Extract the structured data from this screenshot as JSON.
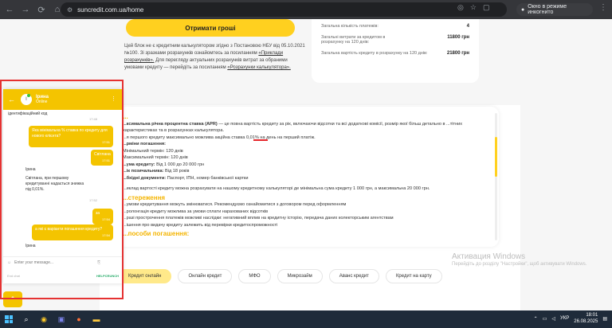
{
  "browser": {
    "url": "suncredit.com.ua/home",
    "incognito_label": "Окно в режиме инкогнито"
  },
  "top": {
    "get_money_btn": "Отримати гроші",
    "notice_text": "Цей блок не є кредитним калькулятором згідно з Постановою НБУ від 05.10.2021 №100. Зі зразками розрахунків ознайомтесь за посиланням",
    "notice_link1": "«Приклади розрахунків».",
    "notice_text2": "Для перегляду актуальних розрахунків витрат за обраними умовами кредиту — перейдіть за посиланням",
    "notice_link2": "«Розрахунки калькулятора».",
    "summary": [
      {
        "label": "Загальна кількість платежів:",
        "value": "4"
      },
      {
        "label": "Загальні витрати за кредитом в розрахунку на 120 днів:",
        "value": "11800 грн"
      },
      {
        "label": "Загальна вартість кредиту в розрахунку на 120 днів:",
        "value": "21800 грн"
      }
    ]
  },
  "apr": {
    "heading": "...",
    "line1_bold": "...ксимальна річна процентна ставка (APR)",
    "line1": "— це повна вартість кредиту за рік, включаючи відсотки та всі додаткові комісії, розмір якої більш детально в ...тітних характеристиках та в розрахунках калькулятора.",
    "line2": "...я першого кредиту максимально можлива акційна ставка 0,01% на день на перший платіж.",
    "terms_h": "...рміни погашення:",
    "term_min": "Мінімальний термін: 120 днів",
    "term_max": "Максимальний термін: 120 днів",
    "sum_label": "...ума кредиту:",
    "sum_val": "Від 1 000 до 20 000 грн",
    "borrower_label": "...ік позичальника:",
    "borrower_val": "Від 18 років",
    "docs_label": "...бхідні документи:",
    "docs_val": "Паспорт, ІПН, номер банківської картки",
    "example": "...иклад вартості кредиту можна розрахувати на нашому кредитному калькуляторі де мінімальна сума кредиту 1 000 грн, а максимальна 20 000 грн.",
    "warn_h": "...стереження",
    "warn1": "...умови кредитування можуть змінюватися. Рекомендуємо ознайомитися з договором перед оформленням",
    "warn2": "...ролонгація кредиту можлива за умови сплати нарахованих відсотків",
    "warn3": "...разі прострочення платежів можливі наслідки: негативний вплив на кредитну історію, передача даних колекторським агентствам",
    "warn4": "...ішення про видачу кредиту залежить від перевірки кредитоспроможності",
    "pay_h": "...пособи погашення:"
  },
  "pills": [
    "Кредит онлайн",
    "Онлайн кредит",
    "МФО",
    "Микрозайм",
    "Аванс кредит",
    "Кредит на карту"
  ],
  "watermark": {
    "title": "Активация Windows",
    "sub": "Перейдіть до розділу \"Настройки\", щоб активувати Windows."
  },
  "chat": {
    "agent_initial": "I",
    "agent_name": "Ірина",
    "agent_status": "Online",
    "messages": [
      {
        "from": "in",
        "text": "ідентифікаційний код",
        "time": "17:48"
      },
      {
        "from": "out",
        "text": "Яка мінімальна % ставка по кредиту для нового клієнта?",
        "time": "17:51"
      },
      {
        "from": "out",
        "text": "Світлана",
        "time": "17:51"
      },
      {
        "from": "in",
        "author": "Ірина",
        "text": "Світлана, при першому кредитуванні надається знижка під 0,01%.",
        "time": "17:52"
      },
      {
        "from": "out",
        "text": "за",
        "time": "17:54"
      },
      {
        "from": "out",
        "text": "а які є варіанти погашення кредиту?",
        "time": "17:54"
      },
      {
        "from": "in",
        "author": "Ірина",
        "text": "",
        "time": ""
      }
    ],
    "input_placeholder": "Enter your message...",
    "footer_left": "End chat",
    "footer_brand": "HELPCRUNCH"
  },
  "taskbar": {
    "lang": "УКР",
    "time": "18:01",
    "date": "26.08.2025"
  }
}
